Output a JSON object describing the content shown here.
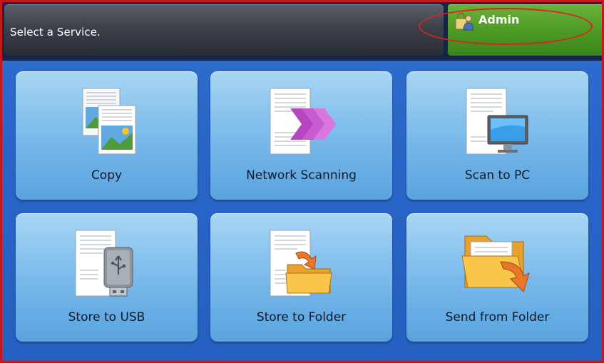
{
  "header": {
    "message": "Select a Service.",
    "login_label": "Admin",
    "login_icon": "user-lock-icon"
  },
  "services": [
    {
      "label": "Copy",
      "icon": "copy-icon"
    },
    {
      "label": "Network Scanning",
      "icon": "network-scan-icon"
    },
    {
      "label": "Scan to PC",
      "icon": "scan-to-pc-icon"
    },
    {
      "label": "Store to USB",
      "icon": "usb-storage-icon"
    },
    {
      "label": "Store to Folder",
      "icon": "store-folder-icon"
    },
    {
      "label": "Send from Folder",
      "icon": "send-folder-icon"
    }
  ],
  "colors": {
    "frame_border": "#c8161d",
    "screen_blue": "#2a66c8",
    "tile_light": "#a9d7f4",
    "tile_dark": "#5aa4de",
    "login_green": "#4b9a24",
    "highlight_ring": "#e02020"
  }
}
